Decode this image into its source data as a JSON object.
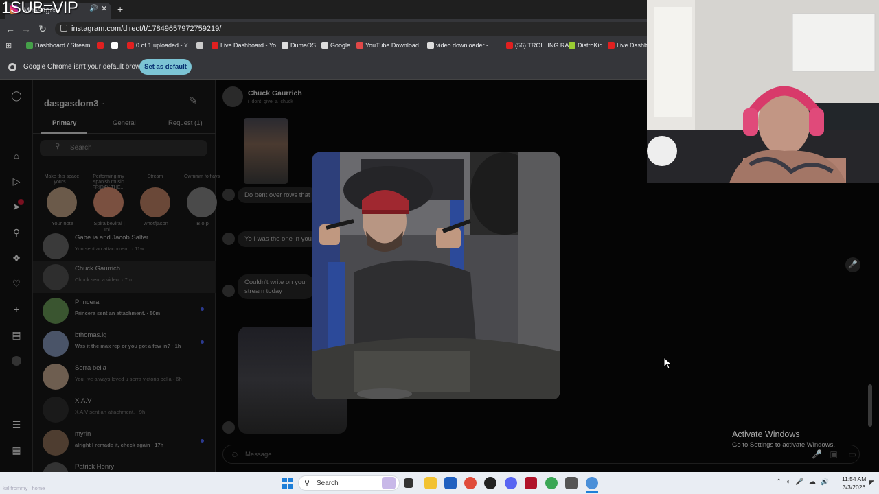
{
  "stream_overlay": {
    "text": "1SUB=VIP"
  },
  "browser": {
    "tab_title": "Messages",
    "url": "instagram.com/direct/t/17849657972759219/",
    "bookmarks": [
      {
        "label": "Dashboard / Stream...",
        "color": "#45a049"
      },
      {
        "label": "",
        "color": "#e02020"
      },
      {
        "label": "",
        "color": "#ffffff"
      },
      {
        "label": "0 of 1 uploaded - Y...",
        "color": "#e02020"
      },
      {
        "label": "",
        "color": "#cccccc"
      },
      {
        "label": "Live Dashboard - Yo...",
        "color": "#e02020"
      },
      {
        "label": "DumaOS",
        "color": "#dddddd"
      },
      {
        "label": "Google",
        "color": "#dddddd"
      },
      {
        "label": "YouTube Download...",
        "color": "#e04848"
      },
      {
        "label": "video downloader -...",
        "color": "#dddddd"
      },
      {
        "label": "(56) TROLLING RAN...",
        "color": "#e02020"
      },
      {
        "label": "DistroKid",
        "color": "#9acd32"
      },
      {
        "label": "Live Dashbo",
        "color": "#e02020"
      }
    ],
    "infobar_text": "Google Chrome isn't your default browser",
    "set_default_label": "Set as default"
  },
  "instagram": {
    "username": "dasgasdom3",
    "tabs": [
      "Primary",
      "General",
      "Request (1)"
    ],
    "search_placeholder": "Search",
    "notes": [
      {
        "note": "Make this space yours...",
        "name": "Your note",
        "color": "#6b5a4a"
      },
      {
        "note": "Performing my spanish music FRIDAY THE...",
        "name": "Spiralbeviral | Inl...",
        "color": "#7a5040"
      },
      {
        "note": "Stream",
        "name": "whotfjason",
        "color": "#6a4838"
      },
      {
        "note": "Gwmmm fo flavs",
        "name": "B.o.p",
        "color": "#4a4a4a"
      }
    ],
    "threads": [
      {
        "name": "Gabe.ia and Jacob Salter",
        "msg": "You sent an attachment. · 11w",
        "unread": false,
        "color": "#3a3a3a"
      },
      {
        "name": "Chuck Gaurrich",
        "msg": "Chuck sent a video. · 7m",
        "unread": false,
        "color": "#2e2e2e"
      },
      {
        "name": "Princera",
        "msg": "Princera sent an attachment. · 50m",
        "unread": true,
        "color": "#3a5530"
      },
      {
        "name": "bthomas.ig",
        "msg": "Was it the max rep or you got a few in? · 1h",
        "unread": true,
        "color": "#4a5468"
      },
      {
        "name": "Serra bella",
        "msg": "You: ive always loved u serra victoria bella · 6h",
        "unread": false,
        "color": "#6e5e50"
      },
      {
        "name": "X.A.V",
        "msg": "X.A.V sent an attachment. · 9h",
        "unread": false,
        "color": "#1a1a1a"
      },
      {
        "name": "myrin",
        "msg": "alright I remade it, check again · 17h",
        "unread": true,
        "color": "#4e3d30"
      },
      {
        "name": "Patrick Henry",
        "msg": "",
        "unread": false,
        "color": "#333333"
      }
    ],
    "chat": {
      "name": "Chuck Gaurrich",
      "handle": "i_dont_give_a_chuck",
      "messages": [
        "Do bent over rows that",
        "Yo I was the one in you",
        "Couldn't write on your\nstream today"
      ],
      "composer_placeholder": "Message..."
    }
  },
  "windows": {
    "activate_title": "Activate Windows",
    "activate_sub": "Go to Settings to activate Windows.",
    "taskbar_search": "Search",
    "time": "11:54 AM",
    "date": "3/3/2026",
    "watermark": "kalifrommy : home"
  }
}
